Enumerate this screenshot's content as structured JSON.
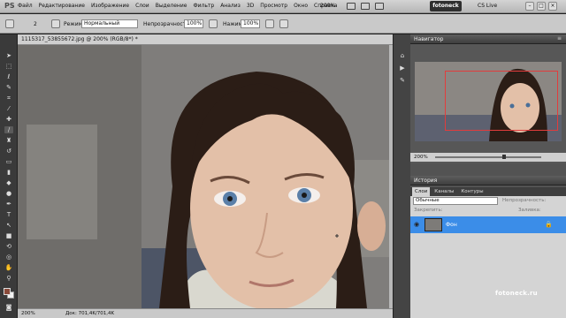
{
  "menubar": {
    "logo": "PS",
    "items": [
      "Файл",
      "Редактирование",
      "Изображение",
      "Слои",
      "Выделение",
      "Фильтр",
      "Анализ",
      "3D",
      "Просмотр",
      "Окно",
      "Справка"
    ],
    "zoom": "200%",
    "brand": "fotoneck",
    "cs_live": "CS Live"
  },
  "options": {
    "brush_size": "2",
    "mode_label": "Режим:",
    "mode_value": "Нормальный",
    "opacity_label": "Непрозрачность:",
    "opacity_value": "100%",
    "pressure_label": "Нажим:",
    "pressure_value": "100%"
  },
  "document": {
    "tab_title": "1115317_53855672.jpg @ 200% (RGB/8*) *",
    "status_zoom": "200%",
    "status_doc": "Док: 701,4K/701,4K"
  },
  "navigator": {
    "title": "Навигатор",
    "zoom": "200%"
  },
  "history": {
    "title": "История"
  },
  "layers": {
    "tabs": [
      "Слои",
      "Каналы",
      "Контуры"
    ],
    "blend_mode": "Обычные",
    "opacity_label": "Непрозрачность:",
    "lock_label": "Закрепить:",
    "fill_label": "Заливка:",
    "layer_name": "Фон"
  },
  "watermark": "fotoneck.ru",
  "colors": {
    "foreground": "#8a4a3a",
    "background": "#f2f2f2",
    "selection": "#3b8de8",
    "navigator_frame": "#e23c3c"
  }
}
